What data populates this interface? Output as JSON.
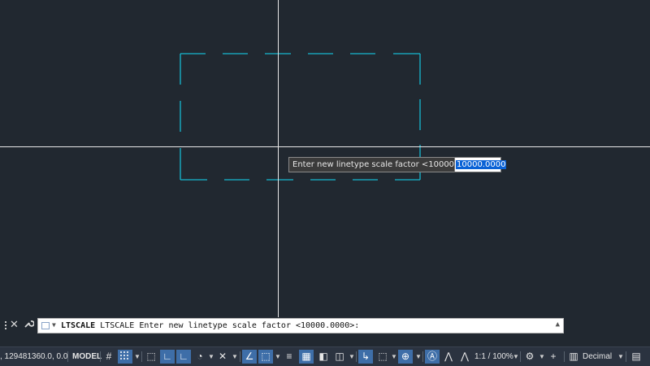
{
  "tooltip": {
    "prompt": "Enter new linetype scale factor <10000.0000>:",
    "input_value": "10000.0000"
  },
  "command_line": {
    "command": "LTSCALE",
    "text": " LTSCALE Enter new linetype scale factor <10000.0000>:"
  },
  "status_bar": {
    "coords": ", 129481360.0, 0.0",
    "model_label": "MODEL",
    "scale_label": "1:1 / 100%",
    "units_label": "Decimal"
  },
  "colors": {
    "background": "#212830",
    "rectangle_line": "#17b9d0",
    "crosshair": "#e8e8e8",
    "status_active": "#3e6ea8"
  },
  "icons": {
    "grid": "grid-icon",
    "snap": "snap-icon",
    "ortho": "ortho-icon",
    "polar": "polar-icon",
    "isodraft": "isodraft-icon",
    "object_snap": "object-snap-icon",
    "gear": "gear-icon",
    "plus": "plus-icon",
    "menu": "hamburger-menu-icon"
  }
}
